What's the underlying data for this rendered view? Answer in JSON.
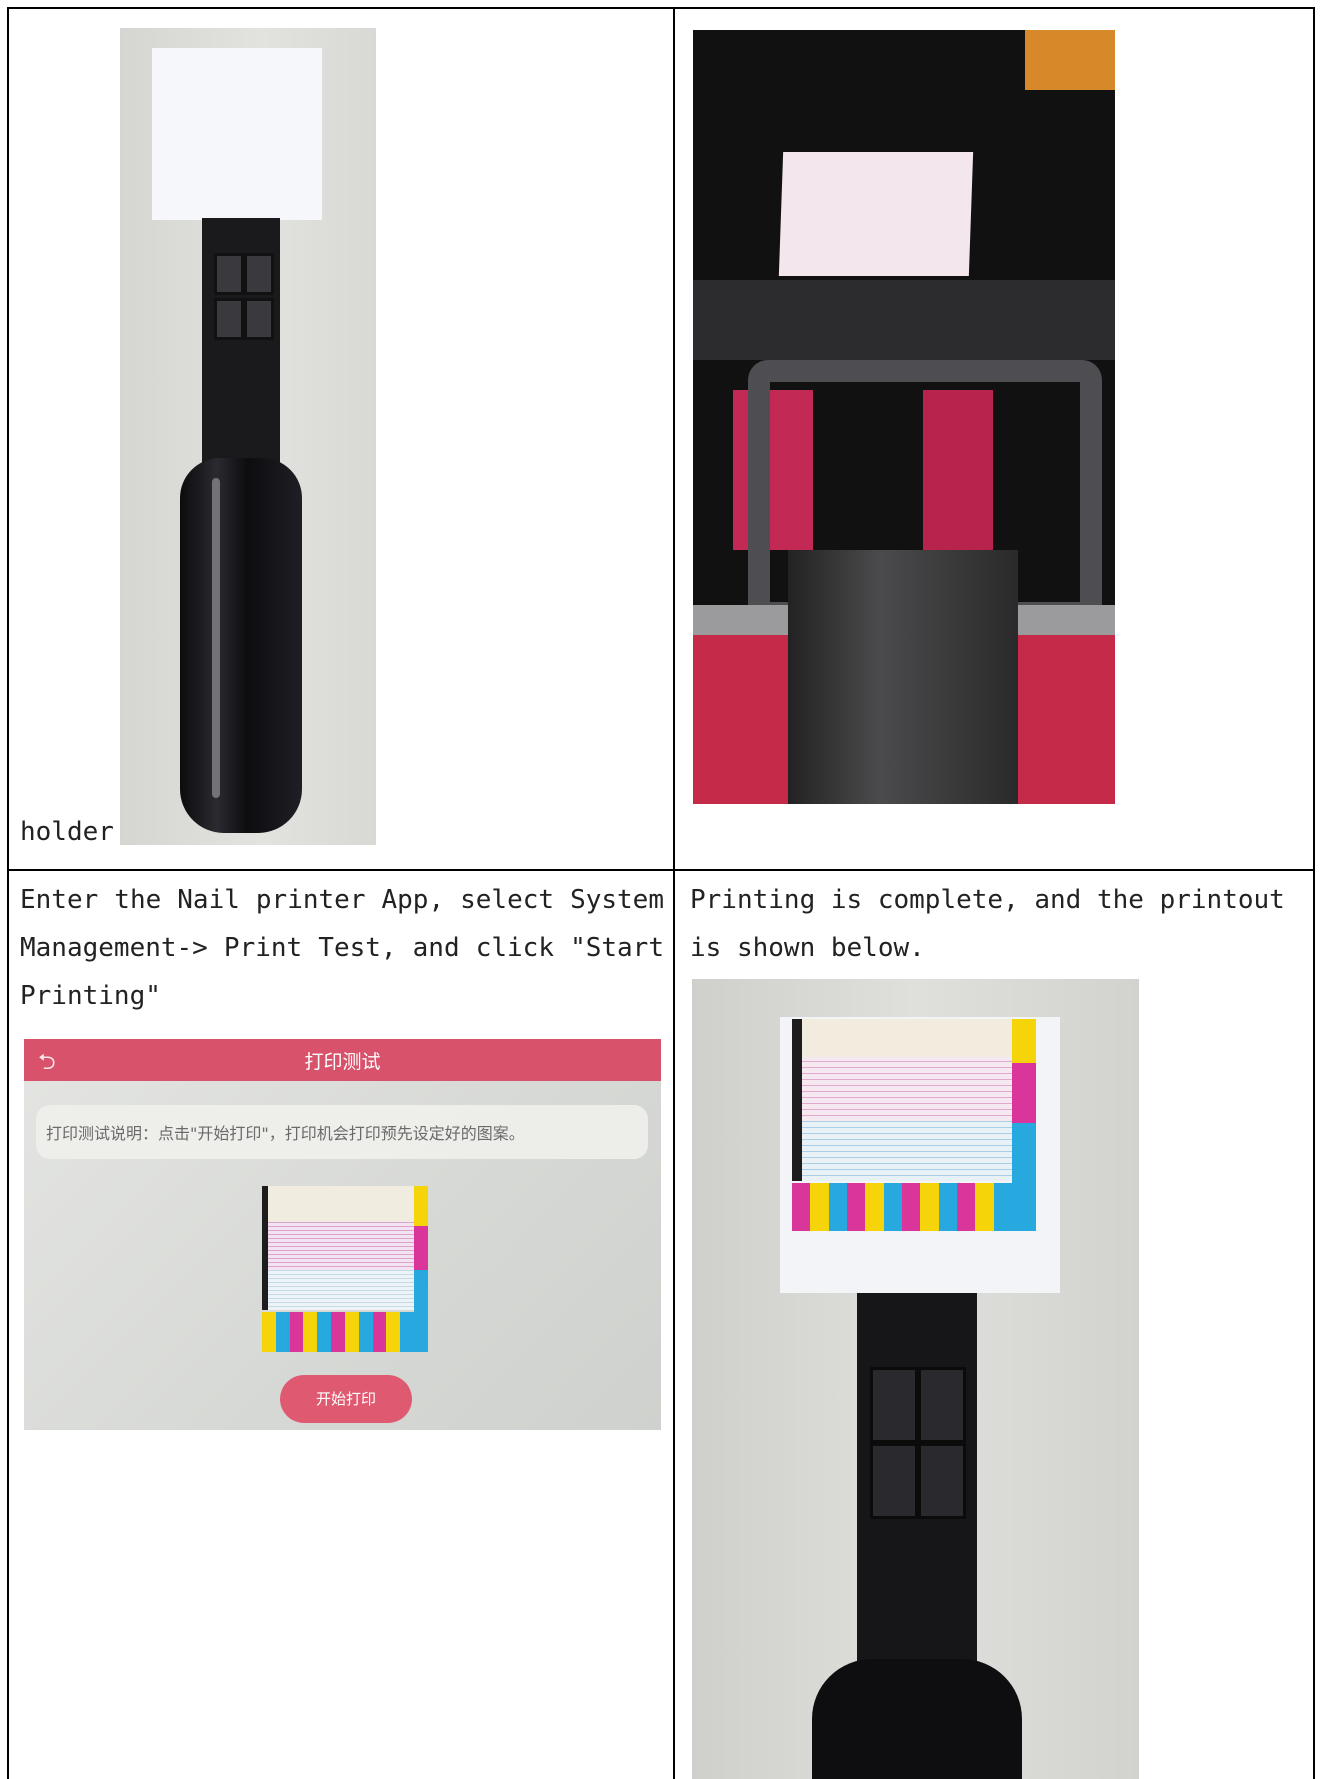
{
  "cells": {
    "top_left_caption": "holder",
    "bottom_left_text": "Enter the Nail printer App, select System Management-> Print Test, and click \"Start Printing\"",
    "bottom_right_text": "Printing is complete, and the printout is shown below."
  },
  "app_screen": {
    "back_icon": "back-arrow-icon",
    "title": "打印测试",
    "notice": "打印测试说明：点击\"开始打印\"，打印机会打印预先设定好的图案。",
    "start_button": "开始打印"
  },
  "colors": {
    "app_accent": "#d9526b",
    "yellow": "#f5d40a",
    "magenta": "#d9359a",
    "cyan": "#27a9df",
    "black": "#1d1d1d"
  }
}
